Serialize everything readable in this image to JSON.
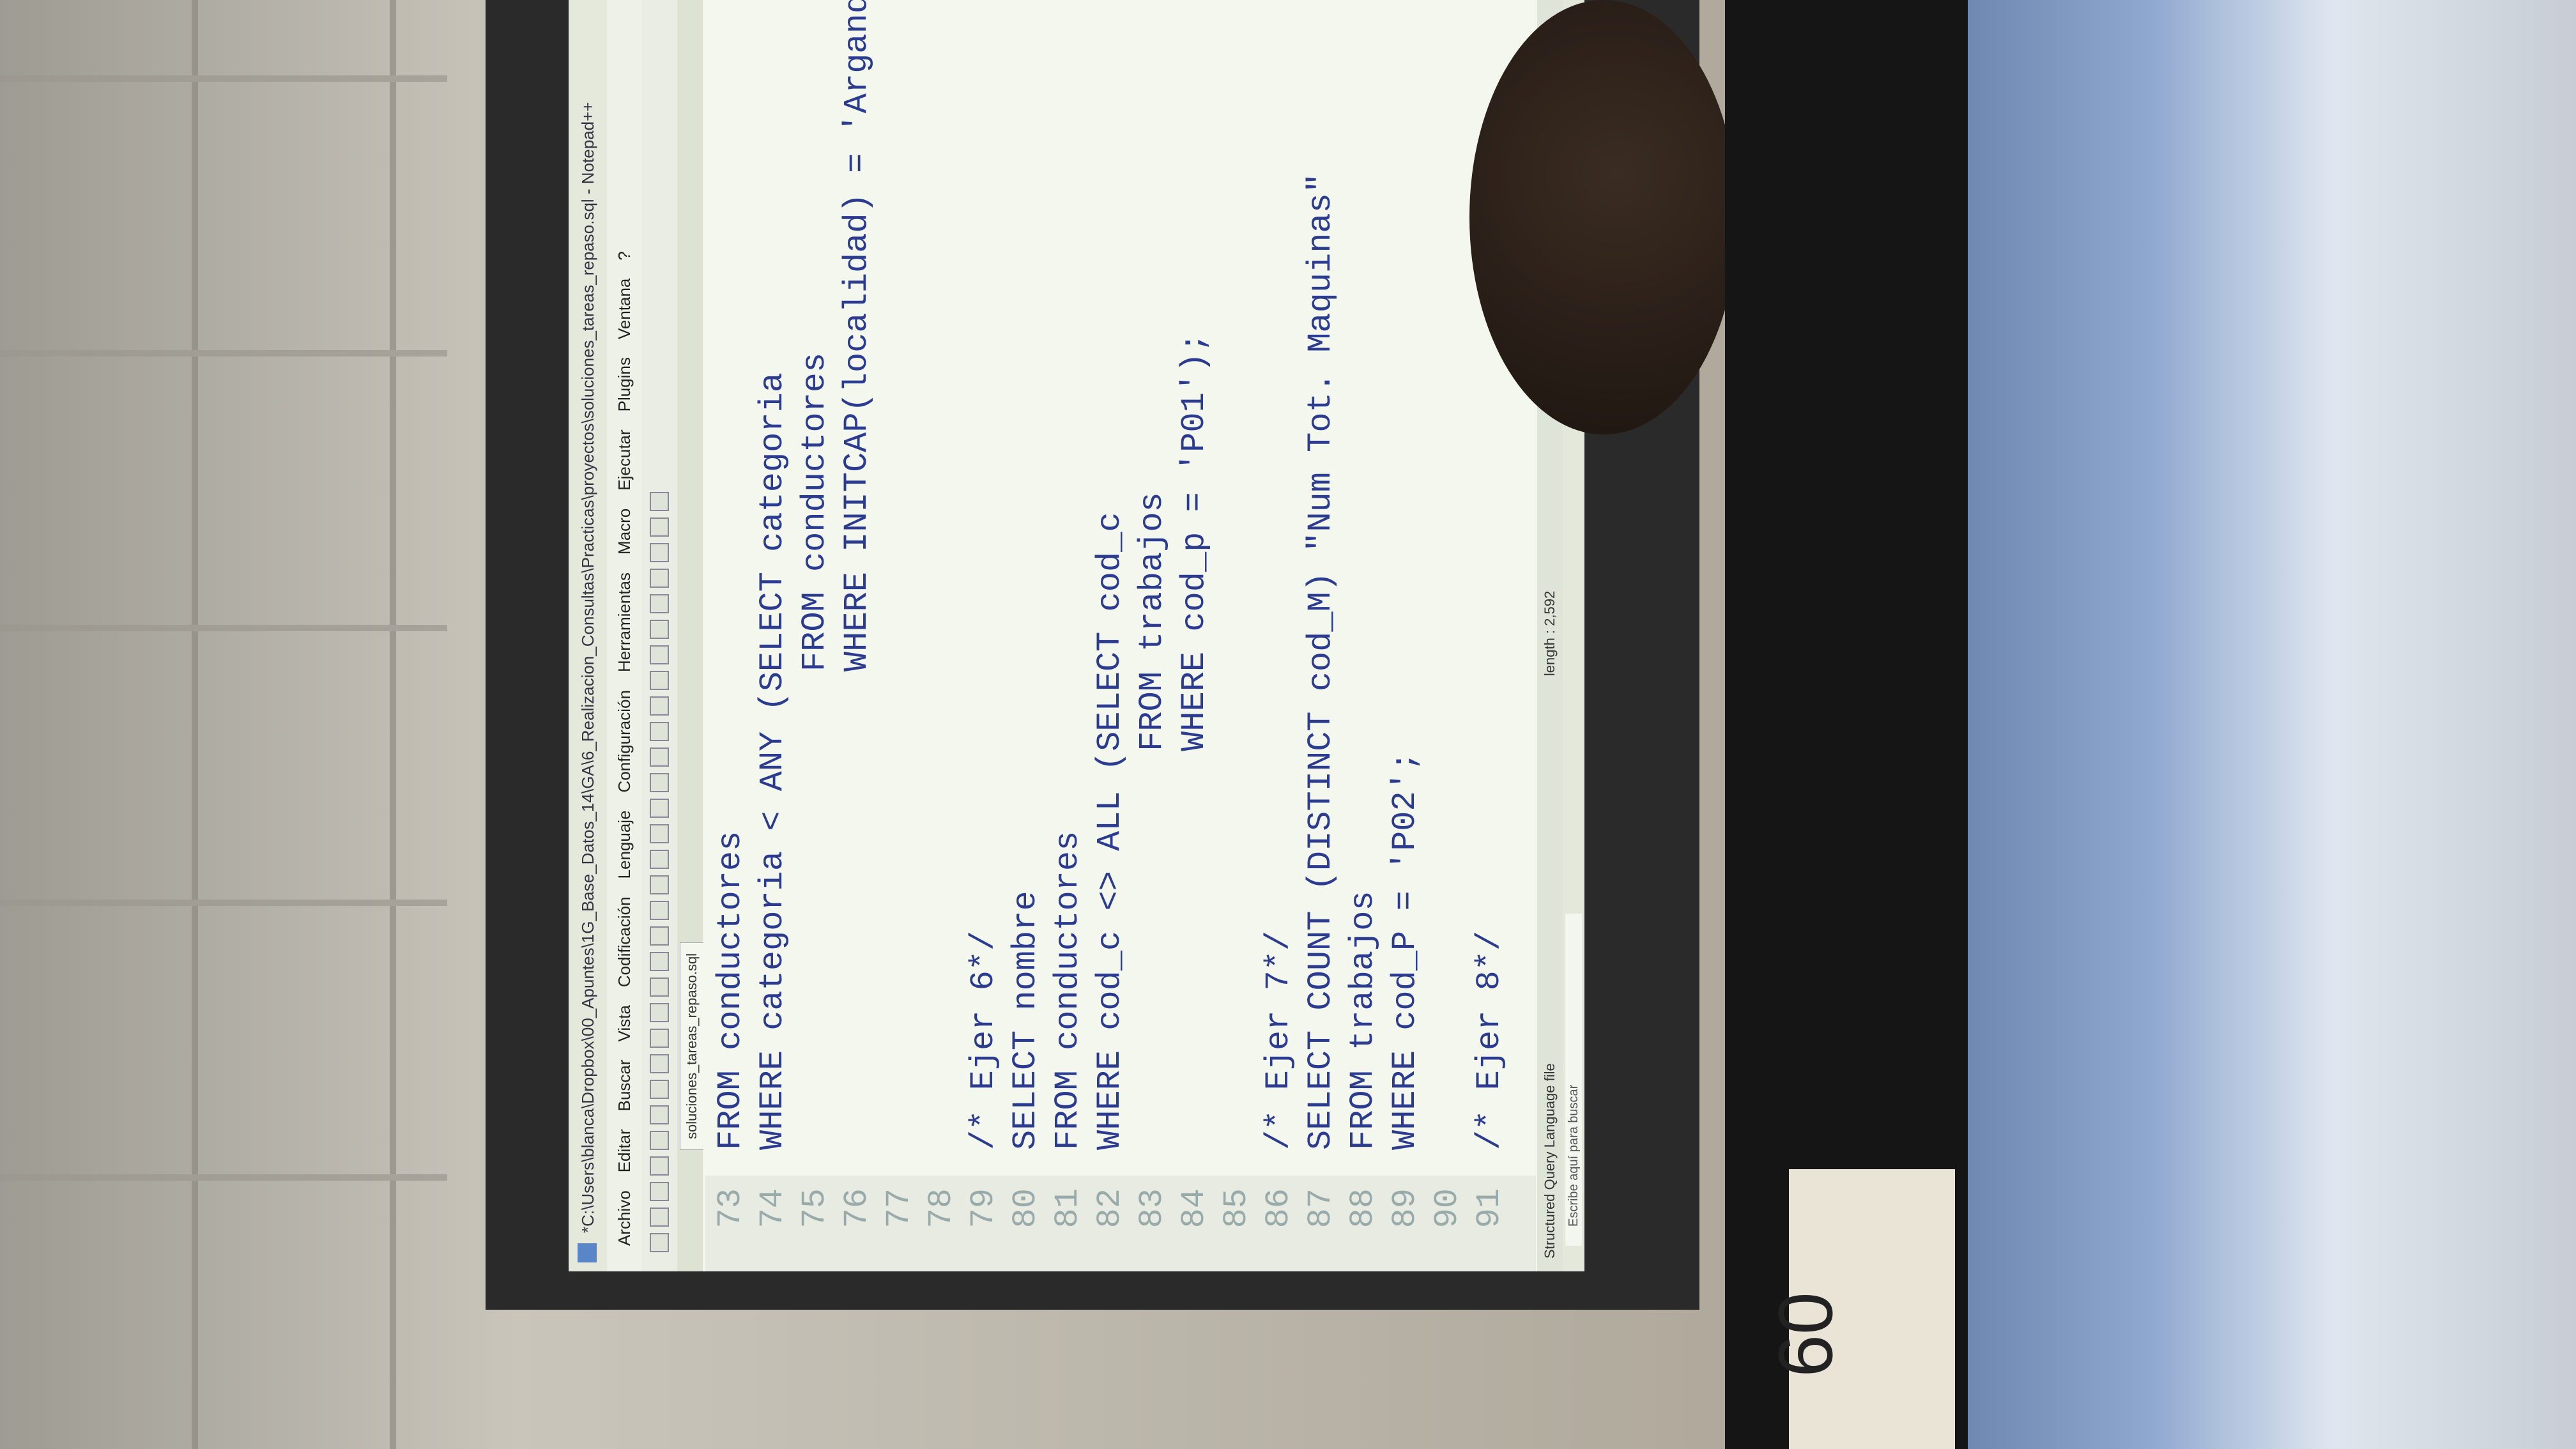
{
  "window": {
    "title": "*C:\\Users\\blanca\\Dropbox\\00_Apuntes\\1G_Base_Datos_14\\GA\\6_Realizacion_Consultas\\Practicas\\proyectos\\soluciones_tareas_repaso.sql - Notepad++",
    "tab": "soluciones_tareas_repaso.sql"
  },
  "menu": [
    "Archivo",
    "Editar",
    "Buscar",
    "Vista",
    "Codificación",
    "Lenguaje",
    "Configuración",
    "Herramientas",
    "Macro",
    "Ejecutar",
    "Plugins",
    "Ventana",
    "?"
  ],
  "code_lines": [
    {
      "n": "73",
      "text": "FROM conductores"
    },
    {
      "n": "74",
      "text": "WHERE categoria < ANY (SELECT categoria"
    },
    {
      "n": "75",
      "text": "                        FROM conductores"
    },
    {
      "n": "76",
      "text": "                        WHERE INITCAP(localidad) = 'Arganda'"
    },
    {
      "n": "77",
      "text": ""
    },
    {
      "n": "78",
      "text": ""
    },
    {
      "n": "79",
      "text": "/* Ejer 6*/"
    },
    {
      "n": "80",
      "text": "SELECT nombre"
    },
    {
      "n": "81",
      "text": "FROM conductores"
    },
    {
      "n": "82",
      "text": "WHERE cod_c <> ALL (SELECT cod_c"
    },
    {
      "n": "83",
      "text": "                    FROM trabajos"
    },
    {
      "n": "84",
      "text": "                    WHERE cod_p = 'P01');"
    },
    {
      "n": "85",
      "text": ""
    },
    {
      "n": "86",
      "text": "/* Ejer 7*/"
    },
    {
      "n": "87",
      "text": "SELECT COUNT (DISTINCT cod_M) \"Num Tot. Maquinas\""
    },
    {
      "n": "88",
      "text": "FROM trabajos"
    },
    {
      "n": "89",
      "text": "WHERE cod_P = 'P02';"
    },
    {
      "n": "90",
      "text": ""
    },
    {
      "n": "91",
      "text": "/* Ejer 8*/"
    }
  ],
  "status": {
    "language": "Structured Query Language file",
    "length": "length : 2,592"
  },
  "taskbar": {
    "search_placeholder": "Escribe aquí para buscar"
  },
  "foreground_label": "60"
}
